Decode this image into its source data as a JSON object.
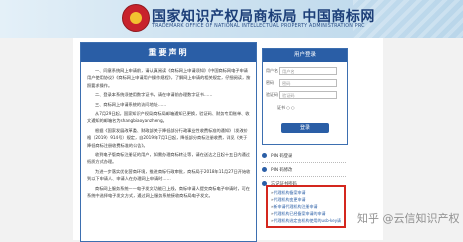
{
  "header": {
    "title": "国家知识产权局商标局 中国商标网",
    "subtitle": "TRADEMARK OFFICE OF NATIONAL INTELLECTUAL PROPERTY ADMINISTRATION PRC"
  },
  "notice": {
    "title": "重要声明",
    "p1": "一、同意系统网上申请前，请认真阅读《商标网上申请须知》《中国商标网电子申请用户使用协议》《商标网上申请用户操作规程》，了解网上申请的相关规定，仔细阅读，按照要求操作。",
    "p2": "二、登录本系统须使用数字证书，请在申请前办理数字证书……",
    "p3": "三、商标网上申请系统的访问地址……",
    "p4": "从7月29日起，国家知识产权局商标局邮箱通知已更换，验证码、财务专用账单、收文通知的邮箱名为shangbiaoyanzheng。",
    "p5": "根据《国家发展改革委、财政部关于降低部分行政事业性收费标准的通知》（发改价格（2019）914号）规定，自2019年7月1日起，降低部分商标注册收费，详见《关于降低商标注册收费标准的公告》。",
    "p6": "收到电子版商标注册证的用户，如需办理商标转让等，请在送达之日起十五日内通过纸质方式办理。",
    "p7": "为进一步落实优化营商环境，推进商标行政审批，商标局于2018年11月27日开始收到以下申请人、申请人在办理网上申请时……",
    "p8": "商标网上服务系统——电子发文功能已上线，商标申请人提交商标电子申请时，可在系统中选择电子发文方式，通过网上服务系统接收商标局电子发文。"
  },
  "login": {
    "title": "用户登录",
    "user_label": "用户名",
    "user_placeholder": "用户名",
    "pwd_label": "密码",
    "pwd_placeholder": "密码",
    "code_label": "验证码",
    "code_placeholder": "验证码",
    "radio_label": "证书 ○  ○",
    "button": "登录"
  },
  "options": [
    {
      "label": "PIN 码登录"
    },
    {
      "label": "PIN 码修改"
    },
    {
      "label": "忘记证书密码"
    }
  ],
  "links": [
    "代理机构备案申请",
    "代理机构变更申请",
    "新申请代理机构注册申请",
    "代理机构已经备案申请的申请",
    "代理机构选定由机构使用的usb-key请求"
  ],
  "watermark": "知乎 @云信知识产权"
}
